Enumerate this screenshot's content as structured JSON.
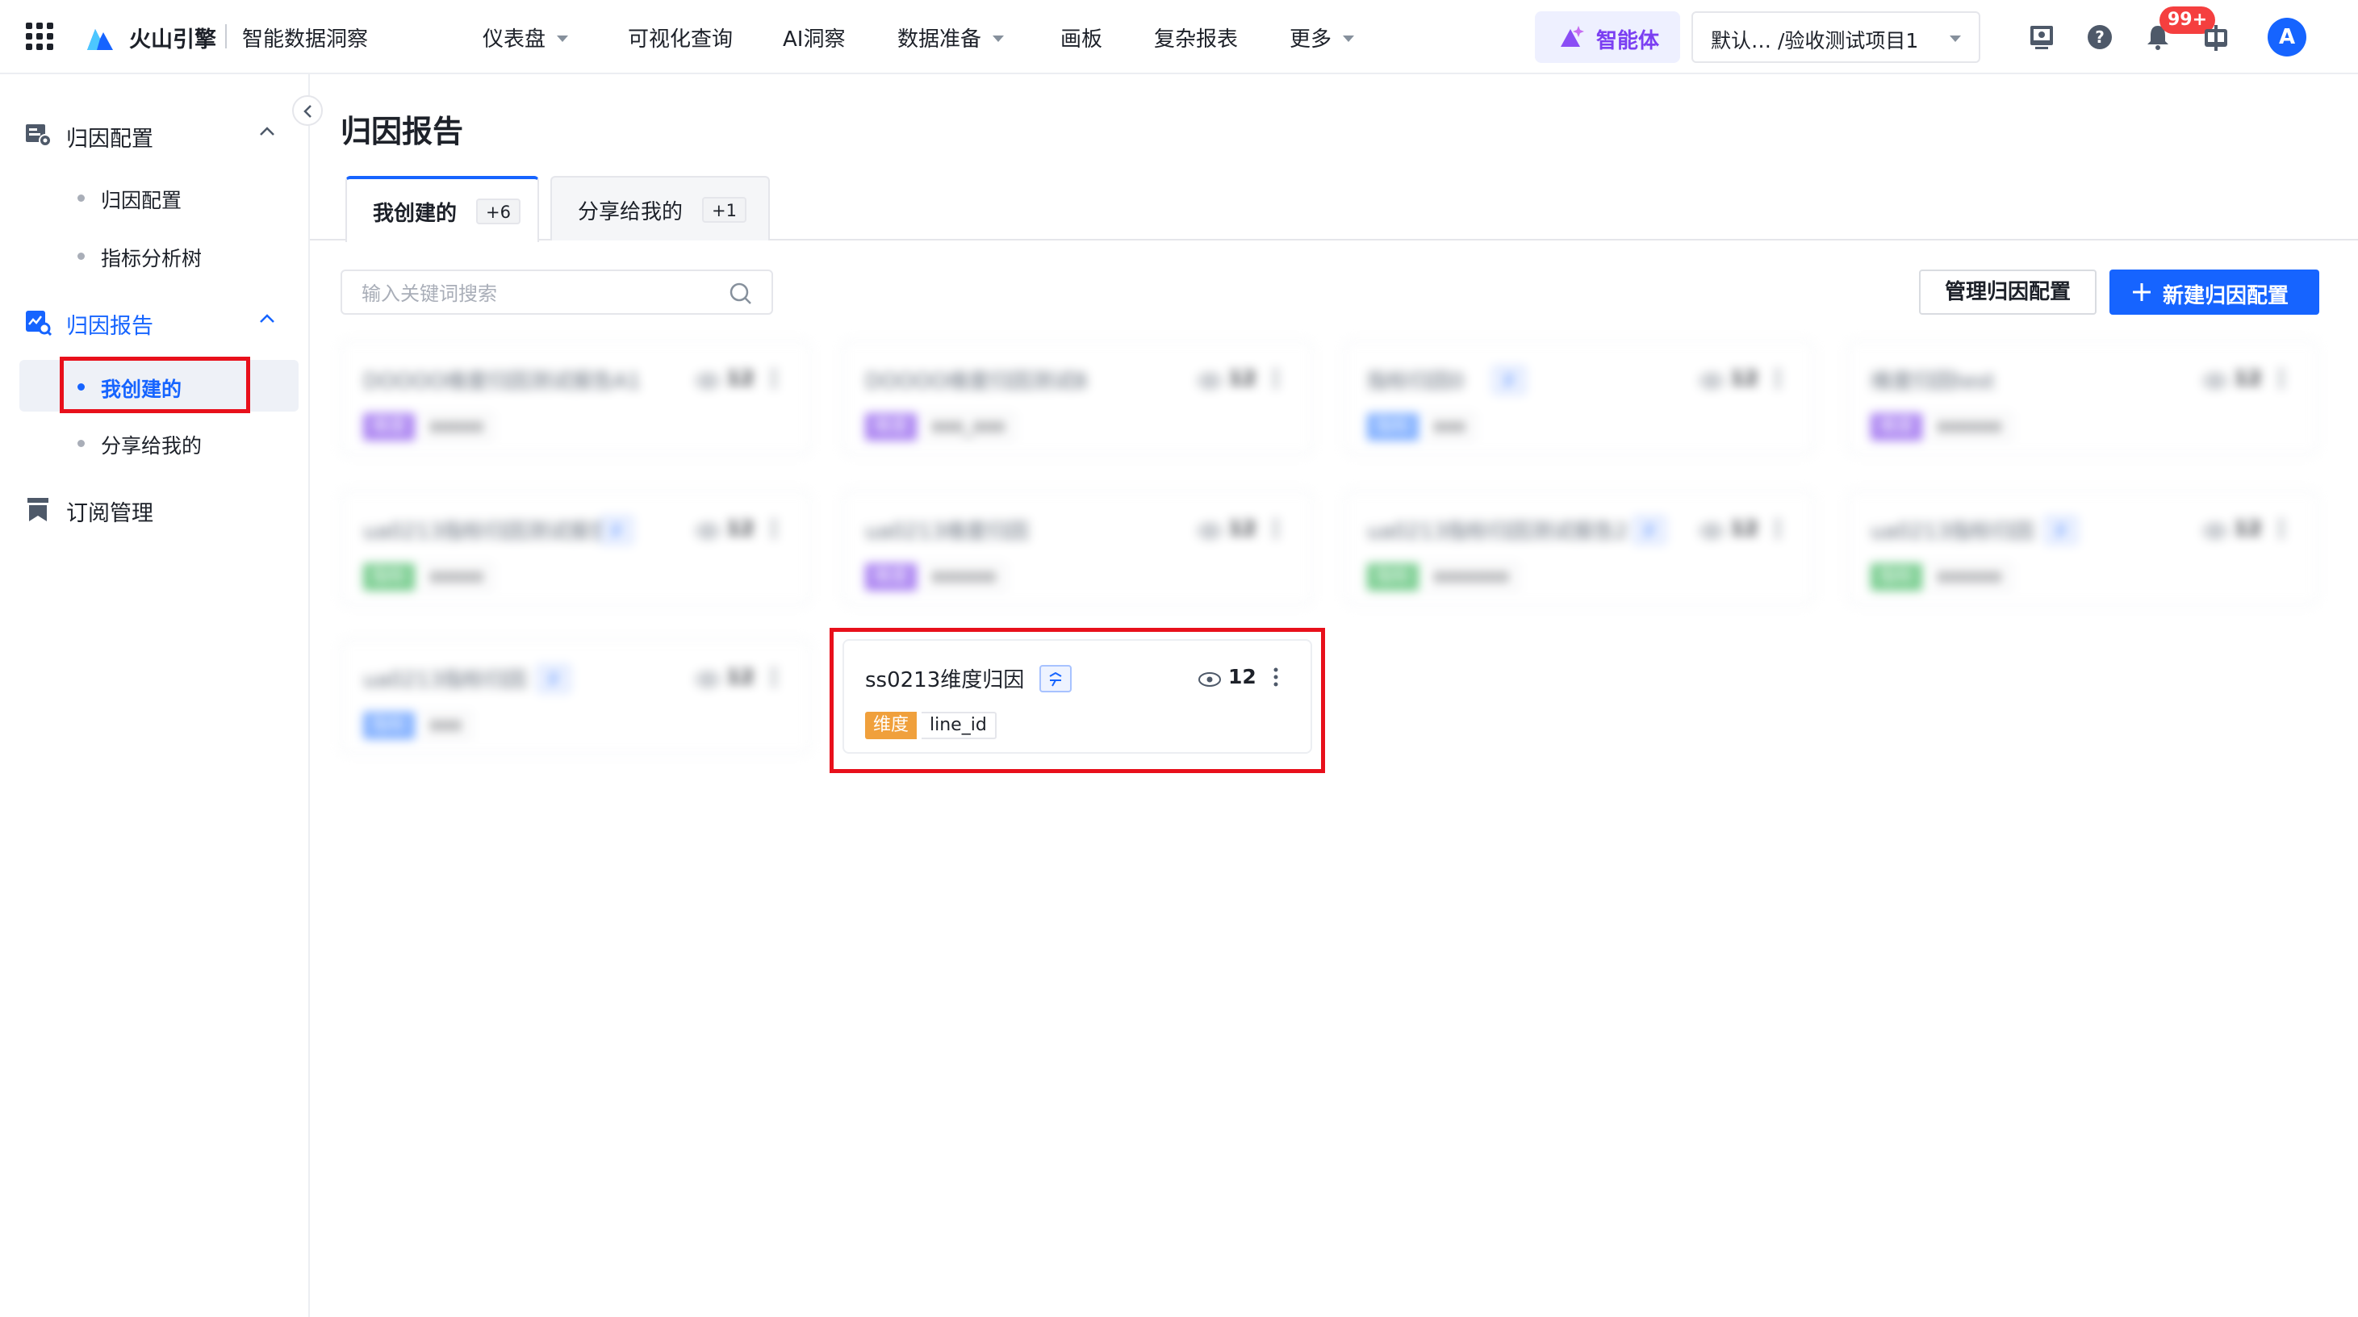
{
  "topbar": {
    "brand_name": "火山引擎",
    "brand_sub": "智能数据洞察",
    "nav": [
      {
        "label": "仪表盘",
        "dropdown": true
      },
      {
        "label": "可视化查询",
        "dropdown": false
      },
      {
        "label": "AI洞察",
        "dropdown": false
      },
      {
        "label": "数据准备",
        "dropdown": true
      },
      {
        "label": "画板",
        "dropdown": false
      },
      {
        "label": "复杂报表",
        "dropdown": false
      },
      {
        "label": "更多",
        "dropdown": true
      }
    ],
    "agent_label": "智能体",
    "project": "默认…  /验收测试项目1",
    "notification_count": "99+",
    "avatar_letter": "A"
  },
  "sidebar": {
    "sections": [
      {
        "label": "归因配置",
        "expanded": true,
        "items": [
          "归因配置",
          "指标分析树"
        ]
      },
      {
        "label": "归因报告",
        "expanded": true,
        "items": [
          "我创建的",
          "分享给我的"
        ]
      },
      {
        "label": "订阅管理"
      }
    ],
    "active_item": "我创建的"
  },
  "main": {
    "title": "归因报告",
    "tabs": [
      {
        "label": "我创建的",
        "count": "+6"
      },
      {
        "label": "分享给我的",
        "count": "+1"
      }
    ],
    "search_placeholder": "输入关键词搜索",
    "manage_button": "管理归因配置",
    "new_button": "新建归因配置",
    "cards": [
      {
        "title": "DOOOO维度归因测试报告A1",
        "tag": "维度",
        "value": "ooooo",
        "views": "12"
      },
      {
        "title": "DOOOO维度归因测试B",
        "tag": "维度",
        "value": "ooo_ooo",
        "views": "12"
      },
      {
        "title": "指标归因0",
        "tag": "指标",
        "value": "ooo",
        "views": "12",
        "shared": true
      },
      {
        "title": "维度归因test",
        "tag": "维度",
        "value": "oooooo",
        "views": "12"
      },
      {
        "title": "ua0213指标归因测试报告",
        "tag": "指标",
        "value": "ooooo",
        "views": "12",
        "shared": true
      },
      {
        "title": "ua0213维度归因",
        "tag": "维度",
        "value": "oooooo",
        "views": "12"
      },
      {
        "title": "ua0213指标归因测试报告2",
        "tag": "指标",
        "value": "ooooooo",
        "views": "12",
        "shared": true
      },
      {
        "title": "ua0213指标归因",
        "tag": "指标",
        "value": "oooooo",
        "views": "12",
        "shared": true
      },
      {
        "title": "ua0213指标归因",
        "tag": "指标",
        "value": "ooo",
        "views": "12",
        "shared": true
      },
      {
        "title": "ss0213维度归因",
        "tag": "维度",
        "value": "line_id",
        "views": "12",
        "shared": true
      }
    ]
  },
  "colors": {
    "accent": "#1664ff",
    "highlight": "#e8101b",
    "tag_dimension": "#f0a03c",
    "tag_metric": "#6aa1ff"
  }
}
